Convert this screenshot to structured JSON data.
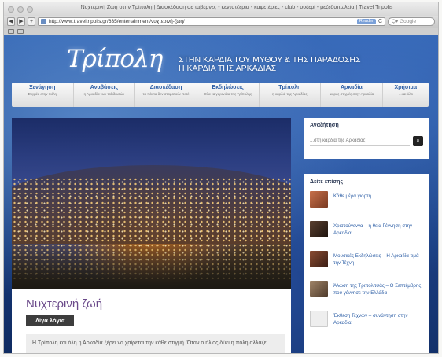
{
  "browser": {
    "window_title": "Νυχτερινή Ζωή στην Τρίπολη | Διασκέδαση σε ταβέρνες - κεντατζερια - καφετέριες - club - ουζερί - μεζεδοπωλεία | Travel Tripolis",
    "url": "http://www.traveltripolis.gr/635/entertainment/νυχτερινή-ζωή/",
    "rss_label": "Reader",
    "search_placeholder": "Google"
  },
  "header": {
    "logo": "Τρίπολη",
    "tagline_line1": "ΣΤΗΝ ΚΑΡΔΙΑ ΤΟΥ ΜΥΘΟΥ & ΤΗΣ ΠΑΡΑΔΟΣΗΣ",
    "tagline_line2": "Η ΚΑΡΔΙΑ ΤΗΣ ΑΡΚΑΔΙΑΣ"
  },
  "nav": [
    {
      "title": "Ξενάγηση",
      "sub": "Στιγμές στην πόλη"
    },
    {
      "title": "Αναβάσεις",
      "sub": "η Αρκαδία των ταξιδιωτών"
    },
    {
      "title": "Διασκέδαση",
      "sub": "τα πάντα δεν σταματούν ποτέ"
    },
    {
      "title": "Εκδηλώσεις",
      "sub": "Όλα τα γεγονότα της Τρίπολης"
    },
    {
      "title": "Τρίπολη",
      "sub": "η καρδιά της Αρκαδίας"
    },
    {
      "title": "Αρκαδία",
      "sub": "μικρές στιγμές στην Αρκαδία"
    },
    {
      "title": "Χρήσιμα",
      "sub": "...και όλα"
    }
  ],
  "article": {
    "title": "Νυχτερινή ζωή",
    "tag": "Λίγα λόγια",
    "excerpt": "Η Τρίπολη και όλη η Αρκαδία ξέρει να χαίρεται την κάθε στιγμή. Όταν ο ήλιος δύει η πόλη αλλάζει..."
  },
  "sidebar": {
    "search_title": "Αναζήτηση",
    "search_placeholder": "...στη καρδιά της Αρκαδίας",
    "related_title": "Δείτε επίσης",
    "related": [
      {
        "label": "Κάθε μέρα γιορτή",
        "thumb_color": "#b0593a"
      },
      {
        "label": "Χριστούγεννα – η θεία Γέννηση στην Αρκαδία",
        "thumb_color": "#3e2b20"
      },
      {
        "label": "Μουσικές Εκδηλώσεις – Η Αρκαδία τιμά την Τέχνη",
        "thumb_color": "#6a3a2a"
      },
      {
        "label": "Άλωση της Τριπολιτσάς – Ο Σεπτέμβρης που γέννησε την Ελλάδα",
        "thumb_color": "#8a6a50"
      },
      {
        "label": "Έκθεση Τεχνών – συνάντηση στην Αρκαδία",
        "thumb_color": "#e6e6e6"
      }
    ]
  }
}
